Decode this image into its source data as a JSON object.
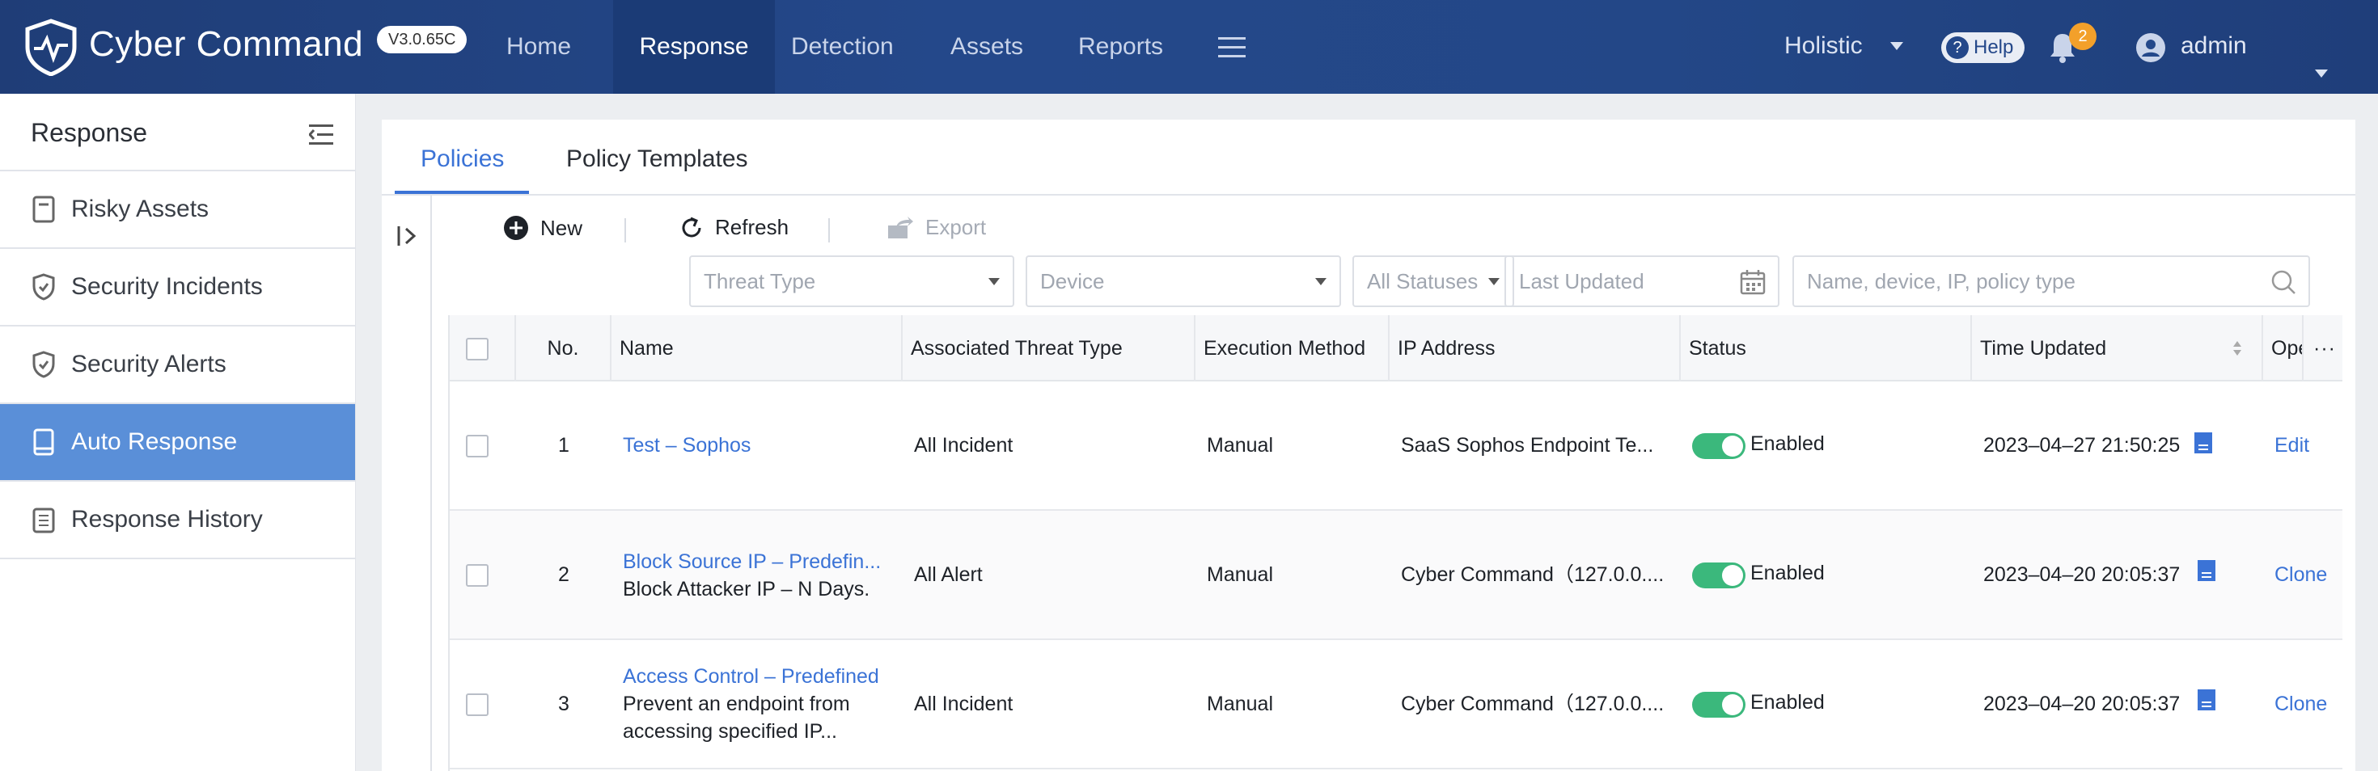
{
  "app": {
    "brand": "Cyber Command",
    "version": "V3.0.65C"
  },
  "nav": {
    "items": [
      "Home",
      "Response",
      "Detection",
      "Assets",
      "Reports"
    ],
    "active": "Response"
  },
  "header": {
    "scope": "Holistic",
    "help": "Help",
    "notifications": "2",
    "user": "admin"
  },
  "sidebar": {
    "title": "Response",
    "items": [
      {
        "label": "Risky Assets",
        "icon": "document-icon"
      },
      {
        "label": "Security Incidents",
        "icon": "shield-icon"
      },
      {
        "label": "Security Alerts",
        "icon": "shield-icon"
      },
      {
        "label": "Auto Response",
        "icon": "book-icon"
      },
      {
        "label": "Response History",
        "icon": "clipboard-icon"
      }
    ],
    "active": "Auto Response"
  },
  "tabs": {
    "items": [
      "Policies",
      "Policy Templates"
    ],
    "active": "Policies"
  },
  "toolbar": {
    "new": "New",
    "refresh": "Refresh",
    "export": "Export"
  },
  "filters": {
    "threat_type": "Threat Type",
    "device": "Device",
    "status": "All Statuses",
    "last_updated": "Last Updated",
    "search_placeholder": "Name, device, IP, policy type"
  },
  "table": {
    "columns": [
      "No.",
      "Name",
      "Associated Threat Type",
      "Execution Method",
      "IP Address",
      "Status",
      "Time Updated",
      "Ope"
    ],
    "rows": [
      {
        "no": "1",
        "name": "Test – Sophos",
        "desc": "",
        "threat": "All Incident",
        "method": "Manual",
        "ip": "SaaS Sophos Endpoint Te...",
        "status": "Enabled",
        "updated": "2023–04–27 21:50:25",
        "op": "Edit"
      },
      {
        "no": "2",
        "name": "Block Source IP – Predefin...",
        "desc": "Block Attacker IP – N Days.",
        "threat": "All Alert",
        "method": "Manual",
        "ip": "Cyber Command（127.0.0....",
        "status": "Enabled",
        "updated": "2023–04–20 20:05:37",
        "op": "Clone"
      },
      {
        "no": "3",
        "name": "Access Control – Predefined",
        "desc": "Prevent an endpoint from",
        "desc2": "accessing specified IP...",
        "threat": "All Incident",
        "method": "Manual",
        "ip": "Cyber Command（127.0.0....",
        "status": "Enabled",
        "updated": "2023–04–20 20:05:37",
        "op": "Clone"
      }
    ]
  },
  "colors": {
    "accent": "#3b73d6",
    "topbar": "#24488a",
    "sidebar_active": "#5a8fd8",
    "toggle_on": "#3bb87c",
    "badge": "#f3a02a"
  }
}
